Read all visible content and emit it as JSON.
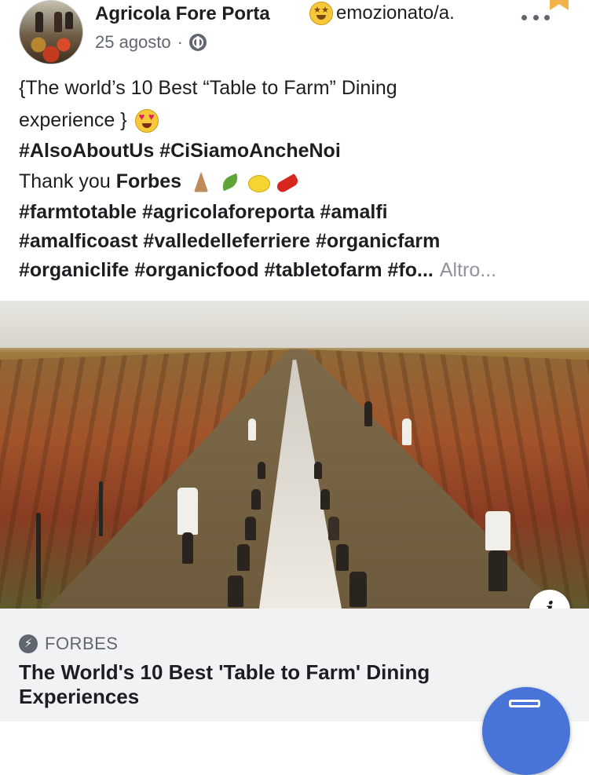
{
  "header": {
    "page_name": "Agricola Fore Porta",
    "feeling": "emozionato/a.",
    "date": "25 agosto",
    "separator": "·"
  },
  "post": {
    "line1": "{The world’s 10 Best “Table to Farm” Dining",
    "line2": "experience }",
    "line3": "#AlsoAboutUs #CiSiamoAncheNoi",
    "thanks_prefix": "Thank you ",
    "thanks_bold": "Forbes",
    "line5": "#farmtotable #agricolaforeporta #amalfi",
    "line6": "#amalficoast #valledelleferriere #organicfarm",
    "line7": "#organiclife #organicfood #tabletofarm #fo...",
    "see_more": "Altro..."
  },
  "link_preview": {
    "source": "FORBES",
    "title": "The World's 10 Best 'Table to Farm' Dining Experiences"
  },
  "info_button": "i",
  "icons": {
    "feeling": "star-struck-emoji-icon",
    "privacy": "globe-icon",
    "more": "more-dots-icon",
    "source": "instant-article-bolt-icon",
    "compose": "compose-pen-icon"
  }
}
